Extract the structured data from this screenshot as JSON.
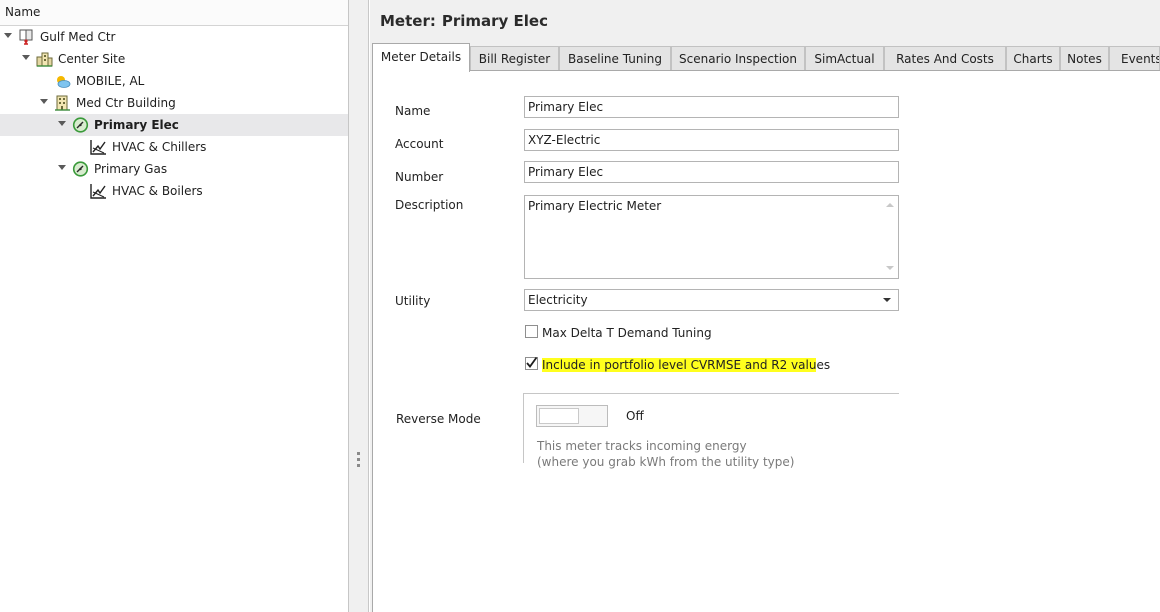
{
  "tree": {
    "header": "Name",
    "nodes": [
      {
        "label": "Gulf Med Ctr",
        "icon": "organization-icon"
      },
      {
        "label": "Center Site",
        "icon": "site-buildings-icon"
      },
      {
        "label": "MOBILE, AL",
        "icon": "weather-icon"
      },
      {
        "label": "Med Ctr Building",
        "icon": "building-icon"
      },
      {
        "label": "Primary Elec",
        "icon": "meter-gauge-icon"
      },
      {
        "label": "HVAC & Chillers",
        "icon": "chart-trend-icon"
      },
      {
        "label": "Primary Gas",
        "icon": "meter-gauge-icon"
      },
      {
        "label": "HVAC & Boilers",
        "icon": "chart-trend-icon"
      }
    ]
  },
  "header": {
    "label": "Meter:",
    "name": "Primary Elec"
  },
  "tabs": [
    {
      "label": "Meter Details"
    },
    {
      "label": "Bill Register"
    },
    {
      "label": "Baseline Tuning"
    },
    {
      "label": "Scenario Inspection"
    },
    {
      "label": "SimActual"
    },
    {
      "label": "Rates And Costs"
    },
    {
      "label": "Charts"
    },
    {
      "label": "Notes"
    },
    {
      "label": "Events"
    }
  ],
  "form": {
    "name_label": "Name",
    "name_value": "Primary Elec",
    "account_label": "Account",
    "account_value": "XYZ-Electric",
    "number_label": "Number",
    "number_value": "Primary Elec",
    "description_label": "Description",
    "description_value": "Primary Electric Meter",
    "utility_label": "Utility",
    "utility_value": "Electricity",
    "max_delta_label": "Max Delta T Demand Tuning",
    "max_delta_checked": false,
    "include_label_highlighted": "Include in portfolio level CVRMSE and R2 valu",
    "include_label_rest": "es",
    "include_checked": true,
    "reverse_mode_label": "Reverse Mode",
    "reverse_mode_state": "Off",
    "reverse_hint_line1": "This meter tracks incoming energy",
    "reverse_hint_line2": "(where you grab kWh from the utility type)"
  },
  "colors": {
    "highlight": "#ffff1e",
    "selected_row": "#e8e8ea",
    "meter_green": "#3a9a3a"
  }
}
